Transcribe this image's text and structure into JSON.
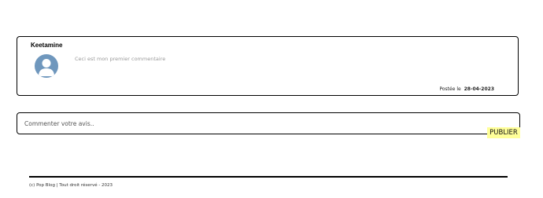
{
  "comment": {
    "author": "Keetamine",
    "text": "Ceci est mon premier commentaire",
    "posted_label": "Postée le",
    "posted_date": "28-04-2023",
    "avatar_icon": "default-user-icon"
  },
  "composer": {
    "placeholder": "Commenter votre avis..",
    "publish_label": "PUBLIER",
    "publish_color": "#ffff99"
  },
  "footer": {
    "copyright": "(c) Pop Blog | Tout droit réservé - 2023"
  }
}
